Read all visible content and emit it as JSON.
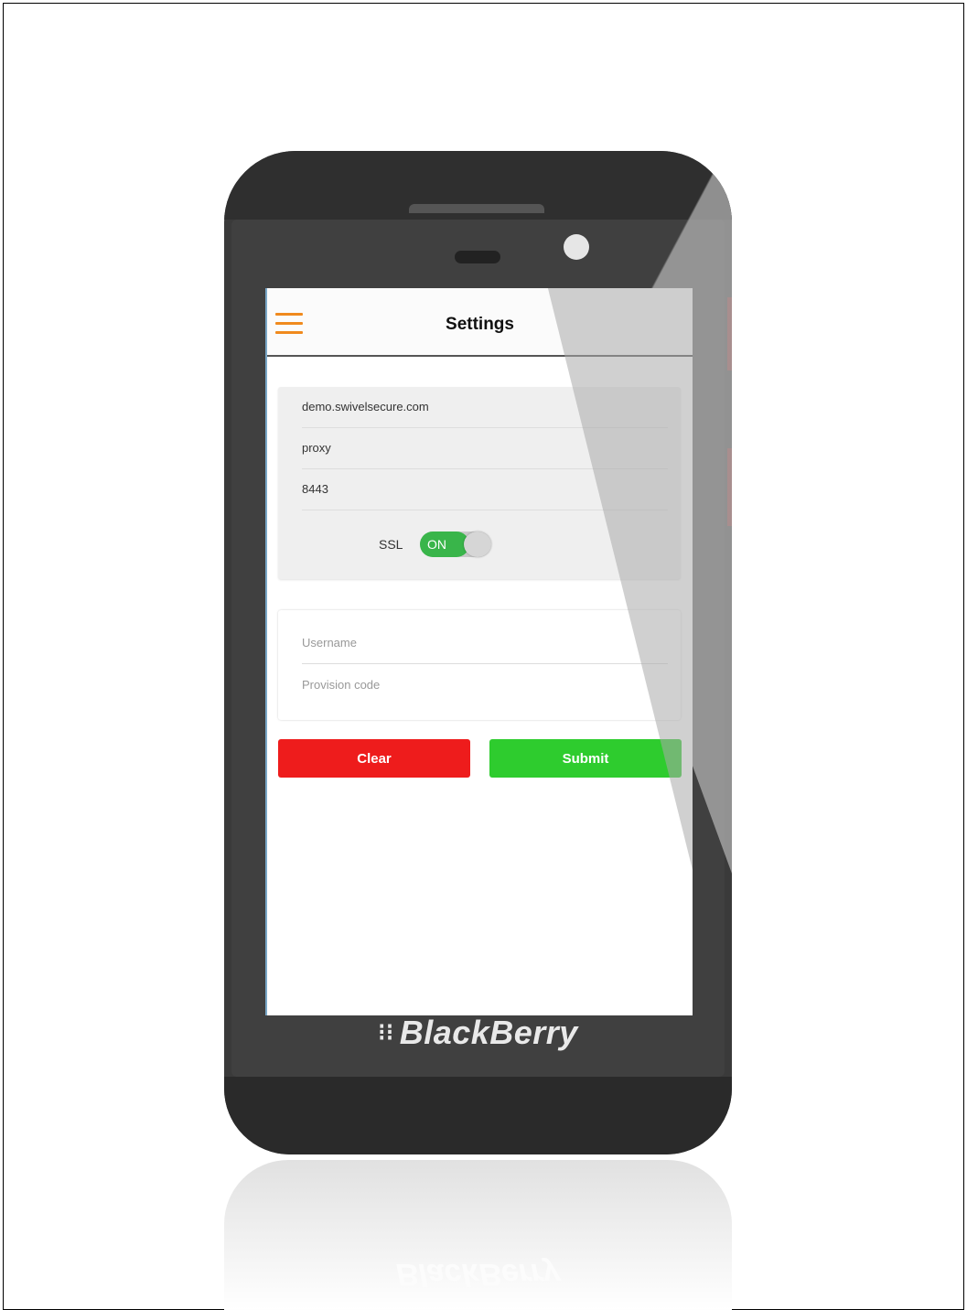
{
  "device": {
    "brand_logo": "BlackBerry",
    "reflection_logo": "BlackBerry"
  },
  "header": {
    "title": "Settings",
    "menu_icon": "hamburger-menu-icon"
  },
  "server_settings": {
    "host_value": "demo.swivelsecure.com",
    "path_value": "proxy",
    "port_value": "8443",
    "ssl_label": "SSL",
    "ssl_toggle_state": "ON"
  },
  "user_settings": {
    "username_placeholder": "Username",
    "provision_code_placeholder": "Provision code"
  },
  "actions": {
    "clear_label": "Clear",
    "submit_label": "Submit"
  },
  "colors": {
    "accent_menu": "#f08a1e",
    "clear_button": "#ee1c1c",
    "submit_button": "#2ecc2e",
    "toggle_on": "#39b54a"
  }
}
